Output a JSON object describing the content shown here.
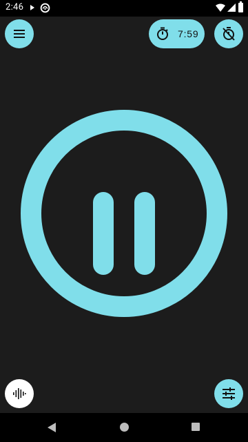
{
  "status_bar": {
    "time": "2:46",
    "icons": [
      "play-icon",
      "app-icon",
      "wifi-icon",
      "signal-icon",
      "battery-icon"
    ]
  },
  "toolbar": {
    "menu_icon": "menu-icon",
    "timer_icon": "stopwatch-icon",
    "timer_remaining": "7:59",
    "timer_cancel_icon": "timer-off-icon"
  },
  "player": {
    "state": "playing",
    "control_icon": "pause-icon"
  },
  "bottom_controls": {
    "left_icon": "waveform-icon",
    "right_icon": "equalizer-sliders-icon"
  },
  "nav_bar": {
    "icons": [
      "back-icon",
      "home-icon",
      "recents-icon"
    ]
  },
  "colors": {
    "accent": "#80deea",
    "background": "#1c1c1c",
    "system_bar": "#000000",
    "icon_on_accent": "#111111"
  }
}
